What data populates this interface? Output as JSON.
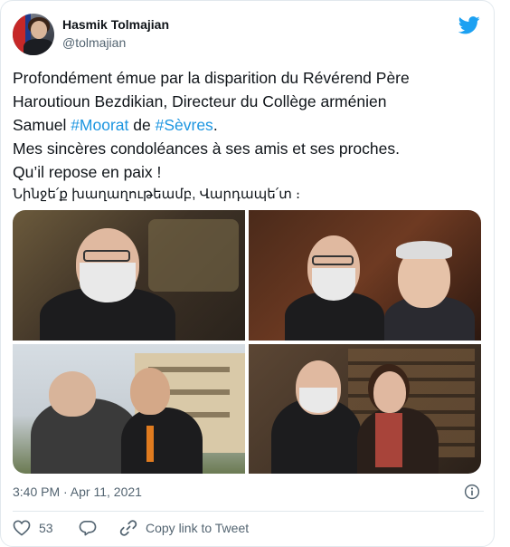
{
  "author": {
    "name": "Hasmik Tolmajian",
    "handle": "@tolmajian"
  },
  "tweet": {
    "line1": "Profondément émue par la disparition du Révérend Père",
    "line2": "Haroutioun Bezdikian, Directeur du Collège arménien",
    "line3_prefix": "Samuel ",
    "line3_hashtag1": "#Moorat",
    "line3_mid": " de ",
    "line3_hashtag2": "#Sèvres",
    "line3_suffix": ".",
    "line4": "Mes sincères condoléances à ses amis et ses proches.",
    "line5": "Qu’il repose en paix !",
    "line6": "Նինջե՛ք խաղաղութեամբ, Վարդապե՛տ ։"
  },
  "meta": {
    "timestamp": "3:40 PM · Apr 11, 2021"
  },
  "actions": {
    "like_count": "53",
    "copy_link_label": "Copy link to Tweet"
  },
  "colors": {
    "accent": "#1da1f2",
    "hashtag": "#1b95e0",
    "muted": "#536471",
    "like": "#e0245e"
  },
  "icons": {
    "brand": "twitter-bird-icon",
    "info": "info-icon",
    "like": "heart-icon",
    "reply": "reply-icon",
    "link": "link-icon"
  }
}
